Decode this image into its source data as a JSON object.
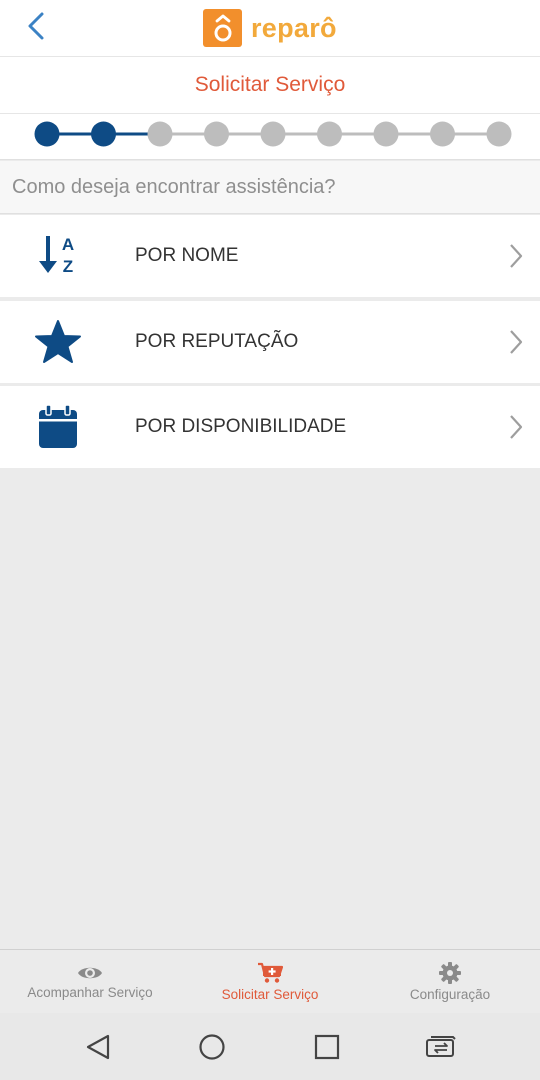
{
  "header": {
    "logo_text": "reparô",
    "logo_icon": "reparo-logo-icon",
    "back_icon": "chevron-left-icon"
  },
  "page": {
    "title": "Solicitar Serviço"
  },
  "stepper": {
    "total_steps": 9,
    "completed_steps": 2,
    "active_color": "#0e4b85",
    "inactive_color": "#bdbdbd"
  },
  "question": "Como deseja encontrar assistência?",
  "options": [
    {
      "label": "POR NOME",
      "icon": "sort-alpha-icon"
    },
    {
      "label": "POR REPUTAÇÃO",
      "icon": "star-icon"
    },
    {
      "label": "POR DISPONIBILIDADE",
      "icon": "calendar-icon"
    }
  ],
  "bottom_nav": [
    {
      "label": "Acompanhar Serviço",
      "icon": "eye-icon",
      "active": false
    },
    {
      "label": "Solicitar Serviço",
      "icon": "cart-plus-icon",
      "active": true
    },
    {
      "label": "Configuração",
      "icon": "gear-icon",
      "active": false
    }
  ],
  "colors": {
    "brand_orange": "#f28f2c",
    "title_red": "#e05a3a",
    "icon_blue": "#0e4b85",
    "nav_inactive": "#8a8a8a"
  }
}
